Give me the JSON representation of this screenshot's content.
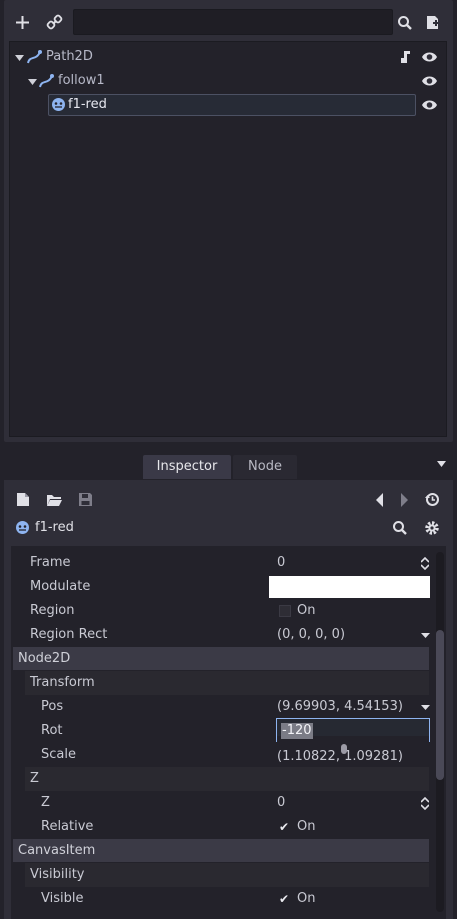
{
  "scene": {
    "search": {
      "value": "",
      "placeholder": ""
    },
    "tree": [
      {
        "label": "Path2D"
      },
      {
        "label": "follow1"
      },
      {
        "label": "f1-red"
      }
    ]
  },
  "tabs": [
    {
      "label": "Inspector"
    },
    {
      "label": "Node"
    }
  ],
  "inspector": {
    "object_name": "f1-red",
    "properties": [
      {
        "name": "Frame",
        "value": "0"
      },
      {
        "name": "Modulate",
        "value": ""
      },
      {
        "name": "Region",
        "value": "On"
      },
      {
        "name": "Region Rect",
        "value": "(0, 0, 0, 0)"
      },
      {
        "name": "Node2D"
      },
      {
        "name": "Transform"
      },
      {
        "name": "Pos",
        "value": "(9.69903, 4.54153)"
      },
      {
        "name": "Rot",
        "value": "-120"
      },
      {
        "name": "Scale",
        "value": "(1.10822, 1.09281)"
      },
      {
        "name": "Z"
      },
      {
        "name": "Z",
        "value": "0"
      },
      {
        "name": "Relative",
        "value": "On"
      },
      {
        "name": "CanvasItem"
      },
      {
        "name": "Visibility"
      },
      {
        "name": "Visible",
        "value": "On"
      }
    ]
  },
  "colors": {
    "accent": "#8eb4f0",
    "panel": "#2f2e38",
    "background": "#23222a"
  }
}
